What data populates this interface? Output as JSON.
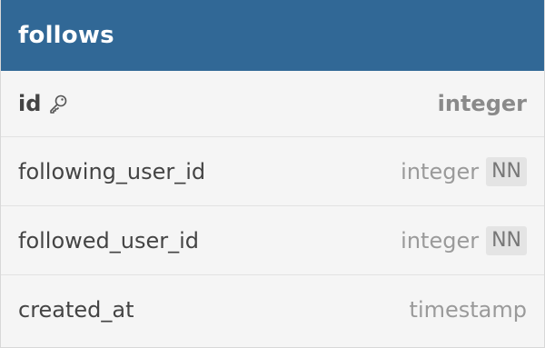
{
  "table": {
    "name": "follows",
    "header_color": "#316896",
    "columns": [
      {
        "name": "id",
        "type": "integer",
        "primary_key": true,
        "not_null": false,
        "badge": ""
      },
      {
        "name": "following_user_id",
        "type": "integer",
        "primary_key": false,
        "not_null": true,
        "badge": "NN"
      },
      {
        "name": "followed_user_id",
        "type": "integer",
        "primary_key": false,
        "not_null": true,
        "badge": "NN"
      },
      {
        "name": "created_at",
        "type": "timestamp",
        "primary_key": false,
        "not_null": false,
        "badge": ""
      }
    ]
  }
}
